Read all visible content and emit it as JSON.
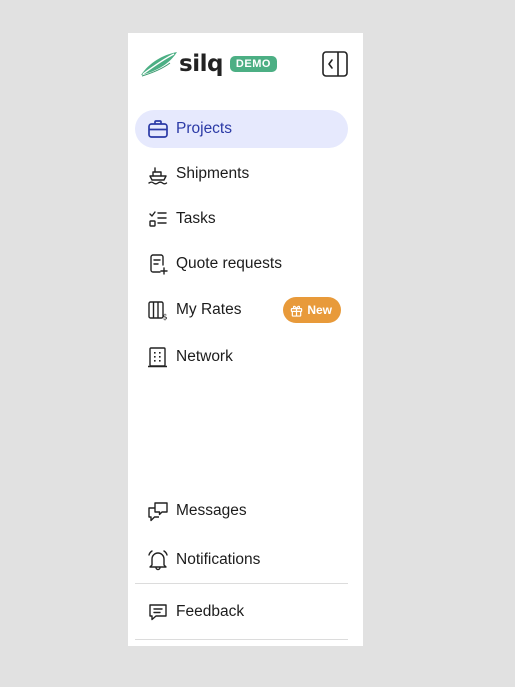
{
  "brand": {
    "name": "silq",
    "badge": "DEMO"
  },
  "nav": {
    "projects": "Projects",
    "shipments": "Shipments",
    "tasks": "Tasks",
    "quote_requests": "Quote requests",
    "my_rates": "My Rates",
    "my_rates_badge": "New",
    "network": "Network"
  },
  "footer": {
    "messages": "Messages",
    "notifications": "Notifications",
    "feedback": "Feedback"
  },
  "colors": {
    "accent": "#2b3aa6",
    "active_bg": "#e6e9fd",
    "brand_green": "#4caf84",
    "badge_orange": "#e89a3a"
  },
  "icons": [
    "leaf-logo-icon",
    "sidebar-collapse-icon",
    "briefcase-icon",
    "ship-icon",
    "checklist-icon",
    "quote-doc-icon",
    "rates-icon",
    "gift-icon",
    "building-icon",
    "messages-icon",
    "bell-icon",
    "feedback-icon"
  ]
}
